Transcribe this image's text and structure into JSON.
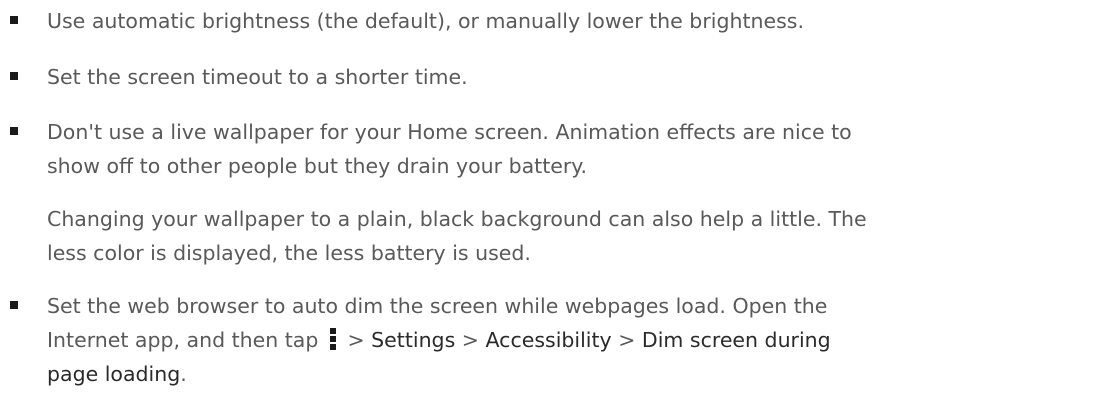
{
  "tips": [
    {
      "lines": [
        "Use automatic brightness (the default), or manually lower the brightness."
      ]
    },
    {
      "lines": [
        "Set the screen timeout to a shorter time."
      ]
    },
    {
      "lines": [
        "Don't use a live wallpaper for your Home screen. Animation effects are nice to",
        "show off to other people but they drain your battery."
      ]
    },
    {
      "lines": [
        "Changing your wallpaper to a plain, black background can also help a little. The",
        "less color is displayed, the less battery is used."
      ]
    },
    {
      "line1": "Set the web browser to auto dim the screen while webpages load. Open the",
      "line2_prefix": "Internet app, and then tap",
      "icon": "overflow-menu-icon",
      "sep1": ">",
      "path1": "Settings",
      "sep2": ">",
      "path2": "Accessibility",
      "sep3": ">",
      "path3_part1": "Dim screen during",
      "path3_part2": "page loading",
      "end": "."
    }
  ]
}
